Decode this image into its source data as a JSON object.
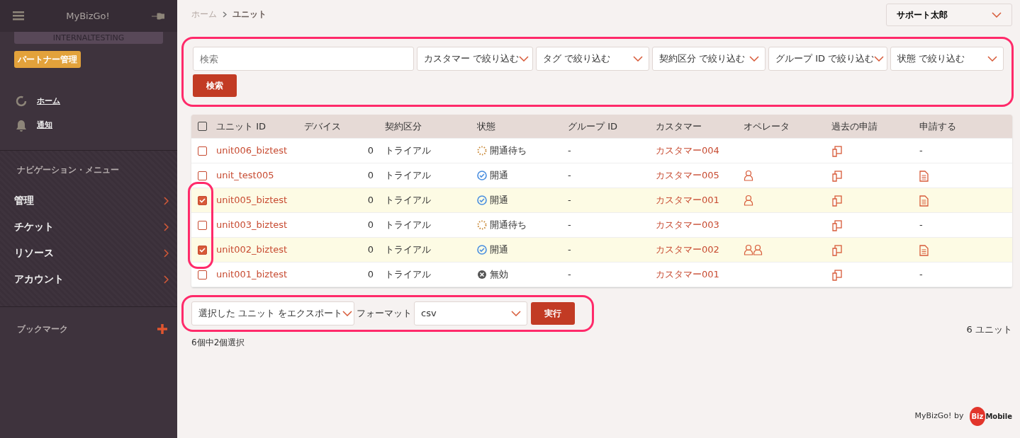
{
  "sidebar": {
    "title": "MyBizGo!",
    "environment": "INTERNALTESTING",
    "badge": "パートナー管理",
    "quick_links": [
      {
        "label": "ホーム"
      },
      {
        "label": "通知"
      }
    ],
    "nav_heading": "ナビゲーション・メニュー",
    "nav_items": [
      {
        "label": "管理"
      },
      {
        "label": "チケット"
      },
      {
        "label": "リソース"
      },
      {
        "label": "アカウント"
      }
    ],
    "bookmarks_heading": "ブックマーク"
  },
  "breadcrumb": [
    {
      "label": "ホーム"
    },
    {
      "label": "ユニット"
    }
  ],
  "user_menu": {
    "label": "サポート太郎"
  },
  "filters": {
    "annotated": true,
    "search": {
      "placeholder": "検索"
    },
    "dropdowns": [
      {
        "label": "カスタマー で絞り込む"
      },
      {
        "label": "タグ で絞り込む"
      },
      {
        "label": "契約区分 で絞り込む"
      },
      {
        "label": "グループ ID で絞り込む"
      },
      {
        "label": "状態 で絞り込む"
      }
    ],
    "button": "検索"
  },
  "table": {
    "select_all_checked": false,
    "columns": [
      "ユニット ID",
      "デバイス",
      "契約区分",
      "状態",
      "グループ ID",
      "カスタマー",
      "オペレータ",
      "過去の申請",
      "申請する"
    ],
    "rows": [
      {
        "selected": false,
        "circled": false,
        "unit_id": "unit006_biztest",
        "devices": "0",
        "contract": "トライアル",
        "status": {
          "kind": "pending",
          "label": "開通待ち"
        },
        "group_id": "-",
        "customer": "カスタマー004",
        "operators": {
          "kind": "none"
        },
        "apply": "-"
      },
      {
        "selected": false,
        "circled": false,
        "unit_id": "unit_test005",
        "devices": "0",
        "contract": "トライアル",
        "status": {
          "kind": "active",
          "label": "開通"
        },
        "group_id": "-",
        "customer": "カスタマー005",
        "operators": {
          "kind": "single"
        },
        "apply": ""
      },
      {
        "selected": true,
        "circled": true,
        "unit_id": "unit005_biztest",
        "devices": "0",
        "contract": "トライアル",
        "status": {
          "kind": "active",
          "label": "開通"
        },
        "group_id": "-",
        "customer": "カスタマー001",
        "operators": {
          "kind": "single"
        },
        "apply": ""
      },
      {
        "selected": false,
        "circled": true,
        "unit_id": "unit003_biztest",
        "devices": "0",
        "contract": "トライアル",
        "status": {
          "kind": "pending",
          "label": "開通待ち"
        },
        "group_id": "-",
        "customer": "カスタマー003",
        "operators": {
          "kind": "none"
        },
        "apply": "-"
      },
      {
        "selected": true,
        "circled": true,
        "unit_id": "unit002_biztest",
        "devices": "0",
        "contract": "トライアル",
        "status": {
          "kind": "active",
          "label": "開通"
        },
        "group_id": "-",
        "customer": "カスタマー002",
        "operators": {
          "kind": "multiple"
        },
        "apply": ""
      },
      {
        "selected": false,
        "circled": false,
        "unit_id": "unit001_biztest",
        "devices": "0",
        "contract": "トライアル",
        "status": {
          "kind": "disabled",
          "label": "無効"
        },
        "group_id": "-",
        "customer": "カスタマー001",
        "operators": {
          "kind": "none"
        },
        "apply": "-"
      }
    ]
  },
  "export": {
    "annotated": true,
    "action": "選択した ユニット をエクスポート",
    "format_label": "フォーマット",
    "format": "csv",
    "button": "実行"
  },
  "selection_summary": "6個中2個選択",
  "count": "6 ユニット",
  "footer": {
    "text": "MyBizGo! by",
    "logo_left": "Biz",
    "logo_right": "Mobile"
  }
}
